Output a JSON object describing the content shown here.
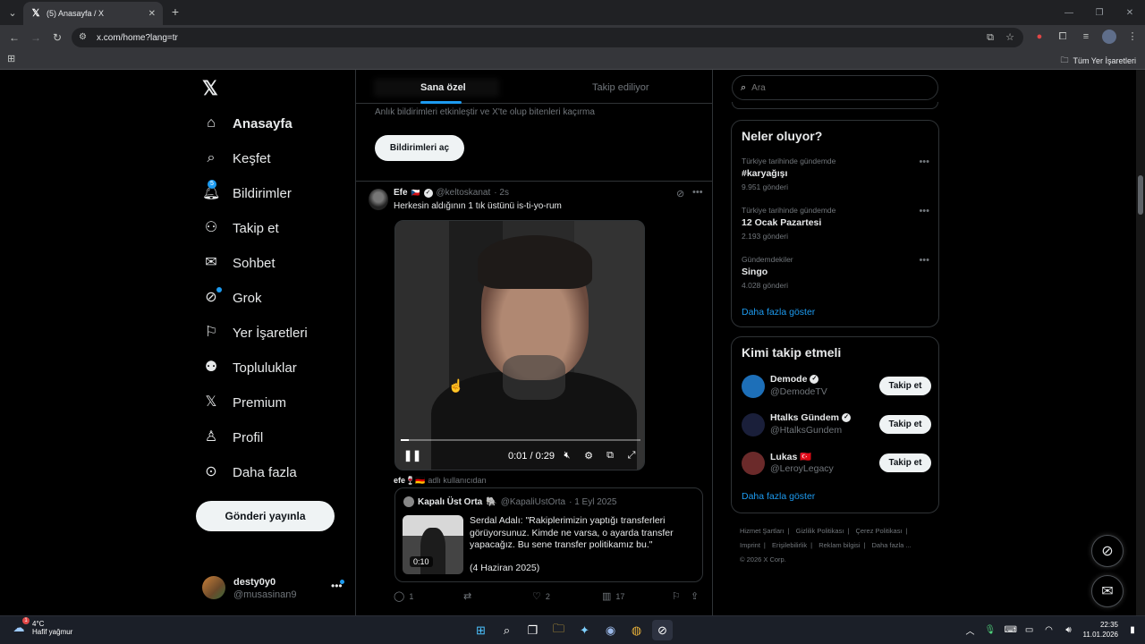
{
  "browser": {
    "tab_title": "(5) Anasayfa / X",
    "url": "x.com/home?lang=tr",
    "all_bookmarks": "Tüm Yer İşaretleri"
  },
  "nav": {
    "items": [
      {
        "label": "Anasayfa",
        "icon": "home-icon"
      },
      {
        "label": "Keşfet",
        "icon": "search-icon"
      },
      {
        "label": "Bildirimler",
        "icon": "bell-icon",
        "badge": "5"
      },
      {
        "label": "Takip et",
        "icon": "person-add-icon"
      },
      {
        "label": "Sohbet",
        "icon": "mail-icon"
      },
      {
        "label": "Grok",
        "icon": "grok-icon"
      },
      {
        "label": "Yer İşaretleri",
        "icon": "bookmark-icon"
      },
      {
        "label": "Topluluklar",
        "icon": "communities-icon"
      },
      {
        "label": "Premium",
        "icon": "x-icon"
      },
      {
        "label": "Profil",
        "icon": "profile-icon"
      },
      {
        "label": "Daha fazla",
        "icon": "more-circle-icon"
      }
    ],
    "post_button": "Gönderi yayınla",
    "account": {
      "name": "desty0y0",
      "handle": "@musasinan9"
    }
  },
  "feed": {
    "tabs": [
      "Sana özel",
      "Takip ediliyor"
    ],
    "notif_prompt": "Anlık bildirimleri etkinleştir ve X'te olup bitenleri kaçırma",
    "notif_button": "Bildirimleri aç",
    "tweet": {
      "name": "Efe",
      "flag": "🇨🇿",
      "handle": "@keltoskanat",
      "time": "· 2s",
      "text": "Herkesin aldığının 1 tık üstünü is-ti-yo-rum",
      "video_time": "0:01 / 0:29",
      "video_progress": 0.034,
      "from_user_name": "efe🍷🇩🇪",
      "from_user_suffix": "adlı kullanıcıdan",
      "quote": {
        "name": "Kapalı Üst Orta",
        "emoji": "🐘",
        "handle": "@KapaliUstOrta",
        "date": "· 1 Eyl 2025",
        "text": "Serdal Adalı: \"Rakiplerimizin yaptığı transferleri görüyorsunuz. Kimde ne varsa, o ayarda transfer yapacağız. Bu sene transfer politikamız bu.\"",
        "date_line": "(4 Haziran 2025)",
        "video_duration": "0:10"
      },
      "actions": {
        "replies": "1",
        "retweets": "",
        "likes": "2",
        "views": "17"
      }
    }
  },
  "right": {
    "search_placeholder": "Ara",
    "trends_title": "Neler oluyor?",
    "trends": [
      {
        "context": "Türkiye tarihinde gündemde",
        "name": "#karyağışı",
        "count": "9.951 gönderi"
      },
      {
        "context": "Türkiye tarihinde gündemde",
        "name": "12 Ocak Pazartesi",
        "count": "2.193 gönderi"
      },
      {
        "context": "Gündemdekiler",
        "name": "Singo",
        "count": "4.028 gönderi"
      }
    ],
    "show_more": "Daha fazla göster",
    "who_title": "Kimi takip etmeli",
    "who": [
      {
        "name": "Demode",
        "handle": "@DemodeTV",
        "verified": true,
        "avatar_color": "#1d6fb8"
      },
      {
        "name": "Htalks Gündem",
        "handle": "@HtalksGundem",
        "verified": true,
        "avatar_color": "#1a1f3a"
      },
      {
        "name": "Lukas",
        "handle": "@LeroyLegacy",
        "badge": "🇹🇷",
        "verified": false,
        "avatar_color": "#6b2a2a"
      }
    ],
    "follow_label": "Takip et",
    "footer": {
      "links": [
        "Hizmet Şartları",
        "Gizlilik Politikası",
        "Çerez Politikası",
        "Imprint",
        "Erişilebilirlik",
        "Reklam bilgisi",
        "Daha fazla ..."
      ],
      "copyright": "© 2026 X Corp."
    }
  },
  "taskbar": {
    "temp": "4°C",
    "weather": "Hafif yağmur",
    "weather_badge": "1",
    "time": "22:35",
    "date": "11.01.2026"
  }
}
